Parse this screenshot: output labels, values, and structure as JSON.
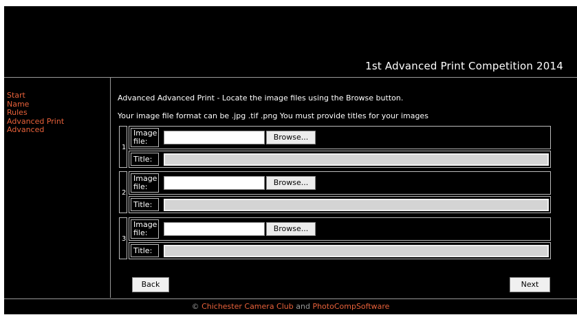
{
  "header": {
    "title": "1st Advanced Print Competition 2014"
  },
  "sidebar": {
    "items": [
      {
        "label": "Start"
      },
      {
        "label": "Name"
      },
      {
        "label": "Rules"
      },
      {
        "label": "Advanced Print"
      },
      {
        "label": "Advanced"
      }
    ]
  },
  "main": {
    "intro_line1": "Advanced Advanced Print - Locate the image files using the Browse button.",
    "intro_line2": "Your image file format can be .jpg .tif .png You must provide titles for your images",
    "image_label": "Image file:",
    "title_label": "Title:",
    "browse_label": "Browse...",
    "entries": [
      {
        "number": "1",
        "file_value": "",
        "title_value": ""
      },
      {
        "number": "2",
        "file_value": "",
        "title_value": ""
      },
      {
        "number": "3",
        "file_value": "",
        "title_value": ""
      }
    ],
    "back_label": "Back",
    "next_label": "Next"
  },
  "footer": {
    "copyright": "©",
    "club_link": "Chichester Camera Club",
    "and": "and",
    "software_link": "PhotoCompSoftware"
  },
  "colors": {
    "background": "#000000",
    "link": "#e8613a",
    "text": "#ffffff",
    "divider": "#9a9a9a"
  }
}
